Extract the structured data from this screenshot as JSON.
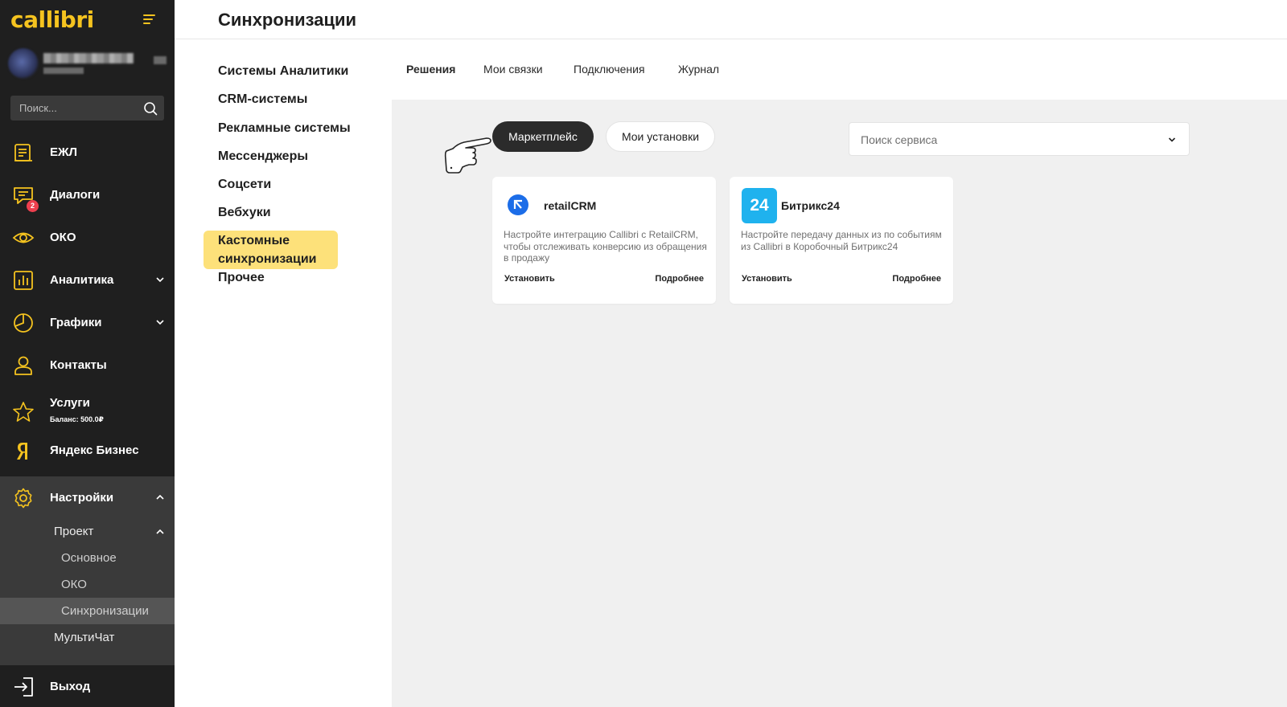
{
  "brand": {
    "logo_text": "callibri",
    "accent": "#f5c31f",
    "sidebar_bg": "#1f1f1f"
  },
  "sidebar": {
    "search_placeholder": "Поиск...",
    "items": [
      {
        "label": "ЕЖЛ",
        "icon": "journal-icon"
      },
      {
        "label": "Диалоги",
        "icon": "chat-icon",
        "badge": "2"
      },
      {
        "label": "ОКО",
        "icon": "eye-icon"
      },
      {
        "label": "Аналитика",
        "icon": "bar-chart-icon"
      },
      {
        "label": "Графики",
        "icon": "pie-chart-icon"
      },
      {
        "label": "Контакты",
        "icon": "user-icon"
      },
      {
        "label": "Услуги",
        "icon": "star-icon",
        "sub": "Баланс: 500.0₽"
      },
      {
        "label": "Яндекс Бизнес",
        "icon": "yandex-icon"
      },
      {
        "label": "Настройки",
        "icon": "gear-icon"
      }
    ],
    "settings_sub": {
      "project": "Проект",
      "children": [
        "Основное",
        "ОКО",
        "Синхронизации"
      ],
      "multichat": "МультиЧат"
    },
    "exit_label": "Выход"
  },
  "header": {
    "title": "Синхронизации"
  },
  "categories": [
    "Системы Аналитики",
    "CRM-системы",
    "Рекламные системы",
    "Мессенджеры",
    "Соцсети",
    "Вебхуки",
    "Кастомные синхронизации",
    "Прочее"
  ],
  "tabs": [
    "Решения",
    "Мои связки",
    "Подключения",
    "Журнал"
  ],
  "filters": {
    "marketplace": "Маркетплейс",
    "my_installs": "Мои установки"
  },
  "service_search": {
    "placeholder": "Поиск сервиса"
  },
  "cards": [
    {
      "name": "retailCRM",
      "description": "Настройте интеграцию Callibri с RetailCRM, чтобы отслеживать конверсию из обращения в продажу",
      "install": "Установить",
      "more": "Подробнее"
    },
    {
      "name": "Битрикс24",
      "logo_text": "24",
      "description": "Настройте передачу данных из по событиям из Callibri в Коробочный Битрикс24",
      "install": "Установить",
      "more": "Подробнее"
    }
  ]
}
